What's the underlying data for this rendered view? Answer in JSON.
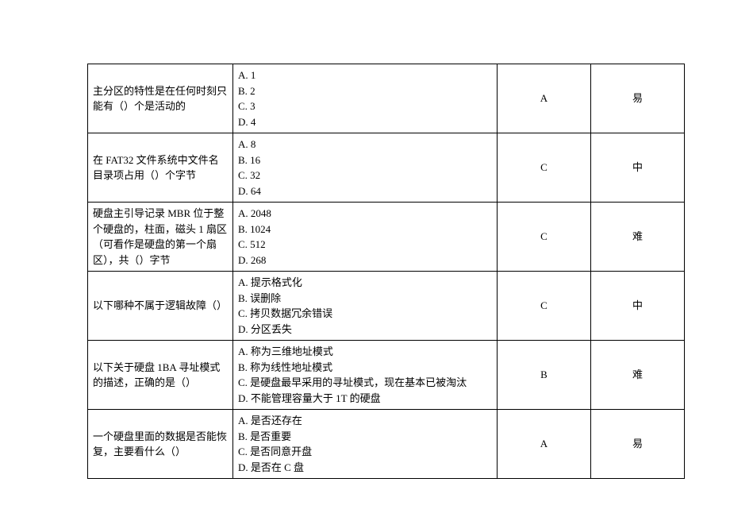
{
  "rows": [
    {
      "question": "主分区的特性是在任何时刻只能有（）个是活动的",
      "options": [
        "A. 1",
        "B. 2",
        "C. 3",
        "D. 4"
      ],
      "answer": "A",
      "difficulty": "易"
    },
    {
      "question": "在 FAT32 文件系统中文件名目录项占用（）个字节",
      "options": [
        "A. 8",
        "B. 16",
        "C. 32",
        "D. 64"
      ],
      "answer": "C",
      "difficulty": "中"
    },
    {
      "question": "硬盘主引导记录 MBR 位于整个硬盘的，柱面，磁头 1 扇区（可看作是硬盘的第一个扇区），共（）字节",
      "options": [
        "A. 2048",
        "B. 1024",
        "C. 512",
        "D. 268"
      ],
      "answer": "C",
      "difficulty": "难"
    },
    {
      "question": "以下哪种不属于逻辑故障（）",
      "options": [
        "A. 提示格式化",
        "B. 误删除",
        "C. 拷贝数据冗余错误",
        "D. 分区丢失"
      ],
      "answer": "C",
      "difficulty": "中"
    },
    {
      "question": "以下关于硬盘 1BA 寻址模式的描述，正确的是（）",
      "options": [
        "A. 称为三维地址模式",
        "B. 称为线性地址模式",
        "C. 是硬盘最早采用的寻址模式，现在基本已被淘汰",
        "D. 不能管理容量大于 1T 的硬盘"
      ],
      "answer": "B",
      "difficulty": "难"
    },
    {
      "question": "一个硬盘里面的数据是否能恢复，主要看什么（）",
      "options": [
        "A. 是否还存在",
        "B. 是否重要",
        "C. 是否同意开盘",
        "D. 是否在 C 盘"
      ],
      "answer": "A",
      "difficulty": "易"
    }
  ]
}
